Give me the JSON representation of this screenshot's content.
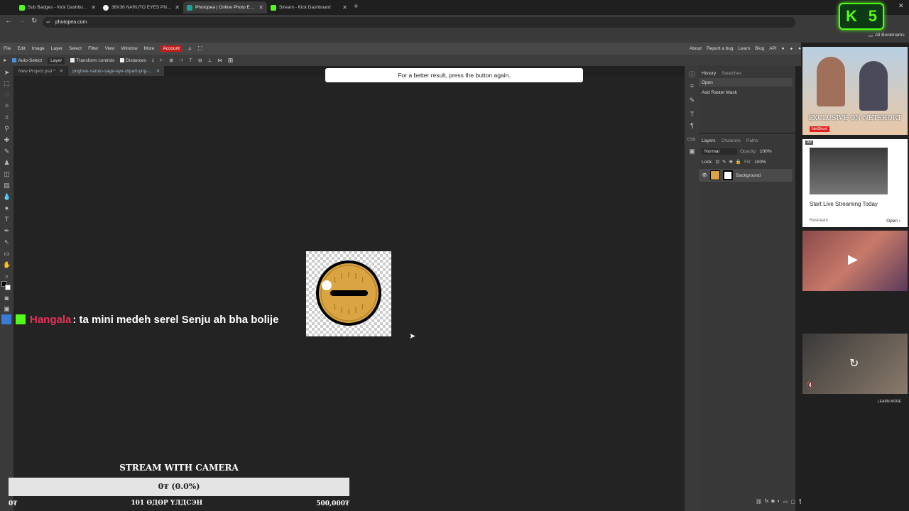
{
  "browser": {
    "tabs": [
      {
        "label": "Sub Badges - Kick Dashboard",
        "color": "#53fc18",
        "active": false
      },
      {
        "label": "36X36 NARUTO EYES PNG - Go",
        "color": "#f2f2f2",
        "active": false
      },
      {
        "label": "Photopea | Online Photo Editor",
        "color": "#18a497",
        "active": true
      },
      {
        "label": "Stream - Kick Dashboard",
        "color": "#53fc18",
        "active": false
      }
    ],
    "url": "photopea.com",
    "bookmarks_label": "All Bookmarks",
    "overlay_badge": "5"
  },
  "photopea": {
    "menu": [
      "File",
      "Edit",
      "Image",
      "Layer",
      "Select",
      "Filter",
      "View",
      "Window",
      "More"
    ],
    "account_label": "Account",
    "menu_right": [
      "About",
      "Report a bug",
      "Learn",
      "Blog",
      "API"
    ],
    "options": {
      "auto_select": "Auto-Select",
      "layer_select": "Layer",
      "transform_controls": "Transform controls",
      "distances": "Distances"
    },
    "doc_tabs": [
      {
        "label": "New Project.psd *"
      },
      {
        "label": "pngtree-naruto-sage-eye-clipart-png-..."
      }
    ],
    "notice": "For a better result, press the button again.",
    "history_panel": {
      "tabs": [
        "History",
        "Swatches"
      ],
      "items": [
        "Open",
        "Add Raster Mask"
      ]
    },
    "layers_panel": {
      "tabs": [
        "Layers",
        "Channels",
        "Paths"
      ],
      "blend_mode": "Normal",
      "opacity_label": "Opacity:",
      "opacity_value": "100%",
      "lock_label": "Lock:",
      "fill_label": "Fill:",
      "fill_value": "100%",
      "layer_name": "Background"
    },
    "css_label": "CSS"
  },
  "ads": {
    "ad1_text": "EXCLUSIVE ON NETSHORT",
    "ad1_brand": "NetShort",
    "ad2_tag": "Ad",
    "ad2_title": "Start Live Streaming Today",
    "ad2_brand": "Restream",
    "ad2_open": "Open",
    "ad4_learn": "LEARN MORE"
  },
  "stream_overlay": {
    "chat_user": "Hangala",
    "chat_message": ": ta mini medeh serel Senju ah bha bolije",
    "goal_title": "STREAM WITH CAMERA",
    "goal_progress_text": "0₮ (0.0%)",
    "goal_progress_value": 0,
    "goal_start": "0₮",
    "goal_middle": "101 ӨДӨР ҮЛДСЭН",
    "goal_end": "500,000₮"
  }
}
